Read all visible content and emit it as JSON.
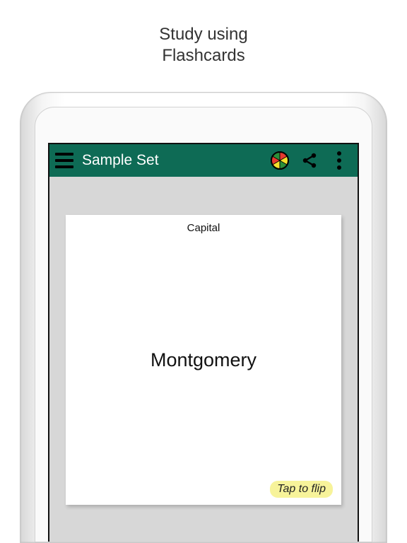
{
  "promo": {
    "line1": "Study using",
    "line2": "Flashcards"
  },
  "header": {
    "title": "Sample Set"
  },
  "card": {
    "heading": "Capital",
    "answer": "Montgomery",
    "flip_hint": "Tap to flip"
  },
  "colors": {
    "header_bg": "#0e6b55",
    "screen_bg": "#d7d7d7",
    "hint_bg": "#f7f39a"
  }
}
